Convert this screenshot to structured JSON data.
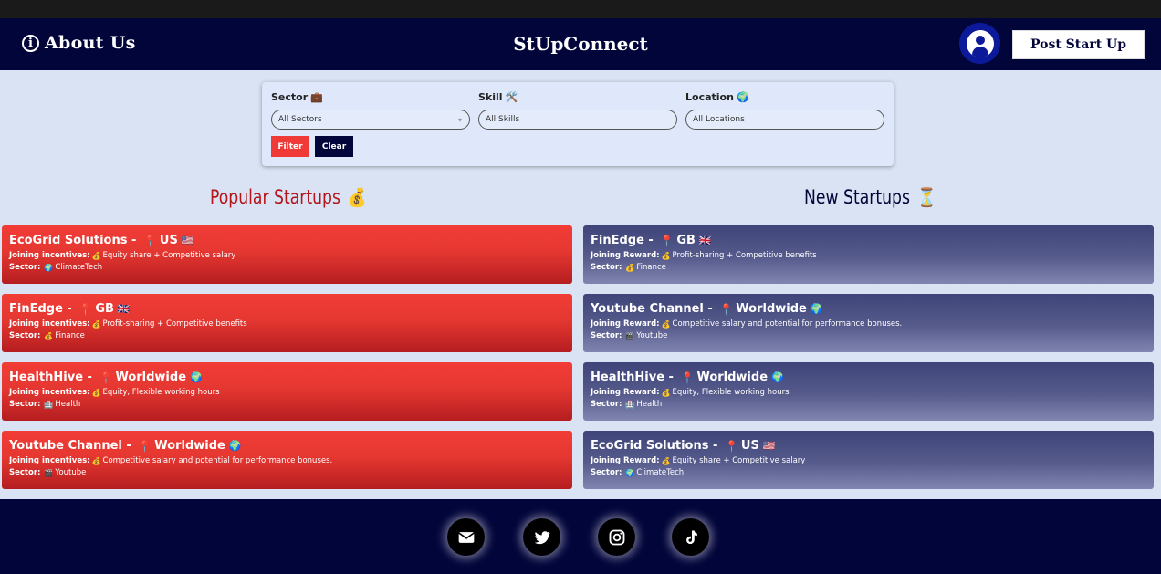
{
  "header": {
    "about_label": "About Us",
    "brand": "StUpConnect",
    "post_button": "Post Start Up"
  },
  "filters": {
    "sector": {
      "label": "Sector",
      "emoji": "💼",
      "value": "All Sectors"
    },
    "skill": {
      "label": "Skill",
      "emoji": "🛠️",
      "value": "All Skills"
    },
    "location": {
      "label": "Location",
      "emoji": "🌍",
      "value": "All Locations"
    },
    "filter_button": "Filter",
    "clear_button": "Clear"
  },
  "popular": {
    "title": "Popular Startups",
    "emoji": "💰",
    "incentive_key": "Joining incentives:",
    "sector_key": "Sector:",
    "cards": [
      {
        "name": "EcoGrid Solutions",
        "location": "US",
        "flag": "🇺🇸",
        "incentive": "Equity share + Competitive salary",
        "sector_emoji": "🌍",
        "sector": "ClimateTech"
      },
      {
        "name": "FinEdge",
        "location": "GB",
        "flag": "🇬🇧",
        "incentive": "Profit-sharing + Competitive benefits",
        "sector_emoji": "💰",
        "sector": "Finance"
      },
      {
        "name": "HealthHive",
        "location": "Worldwide",
        "flag": "🌍",
        "incentive": "Equity, Flexible working hours",
        "sector_emoji": "🏥",
        "sector": "Health"
      },
      {
        "name": "Youtube Channel",
        "location": "Worldwide",
        "flag": "🌍",
        "incentive": "Competitive salary and potential for performance bonuses.",
        "sector_emoji": "🎬",
        "sector": "Youtube"
      }
    ]
  },
  "new": {
    "title": "New Startups",
    "emoji": "⏳",
    "incentive_key": "Joining Reward:",
    "sector_key": "Sector:",
    "cards": [
      {
        "name": "FinEdge",
        "location": "GB",
        "flag": "🇬🇧",
        "incentive": "Profit-sharing + Competitive benefits",
        "sector_emoji": "💰",
        "sector": "Finance"
      },
      {
        "name": "Youtube Channel",
        "location": "Worldwide",
        "flag": "🌍",
        "incentive": "Competitive salary and potential for performance bonuses.",
        "sector_emoji": "🎬",
        "sector": "Youtube"
      },
      {
        "name": "HealthHive",
        "location": "Worldwide",
        "flag": "🌍",
        "incentive": "Equity, Flexible working hours",
        "sector_emoji": "🏥",
        "sector": "Health"
      },
      {
        "name": "EcoGrid Solutions",
        "location": "US",
        "flag": "🇺🇸",
        "incentive": "Equity share + Competitive salary",
        "sector_emoji": "🌍",
        "sector": "ClimateTech"
      }
    ]
  },
  "common": {
    "pin": "📍",
    "dash": " - ",
    "money": "💰"
  },
  "footer": {
    "icons": [
      "mail-icon",
      "twitter-icon",
      "instagram-icon",
      "tiktok-icon"
    ]
  },
  "colors": {
    "navy": "#02053a",
    "red": "#ef3a37",
    "dark_red": "#b3151a",
    "page_bg": "#d9e3f3"
  }
}
